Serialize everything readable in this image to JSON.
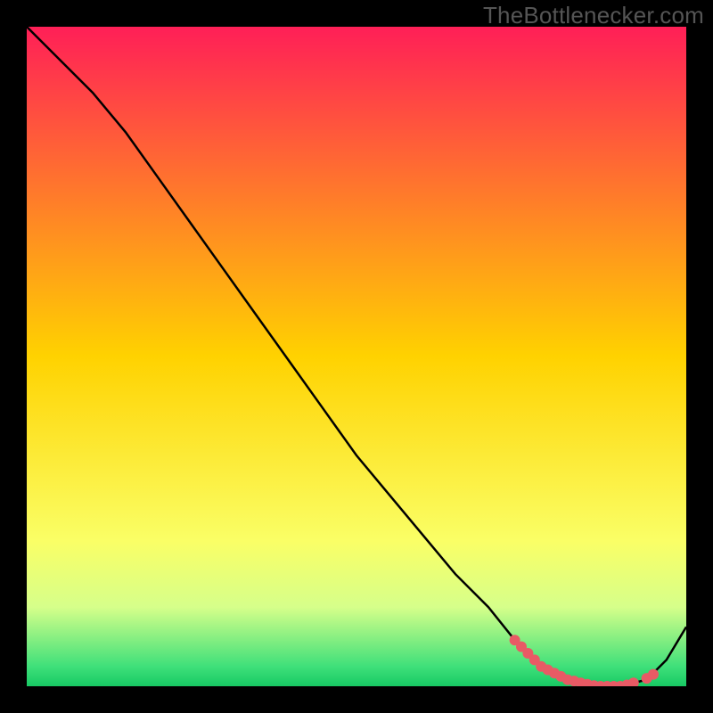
{
  "watermark": "TheBottlenecker.com",
  "chart_data": {
    "type": "line",
    "title": "",
    "xlabel": "",
    "ylabel": "",
    "xlim": [
      0,
      100
    ],
    "ylim": [
      0,
      100
    ],
    "grid": false,
    "legend": false,
    "gradient_stops": [
      {
        "offset": 0.0,
        "color": "#ff1f57"
      },
      {
        "offset": 0.5,
        "color": "#ffd200"
      },
      {
        "offset": 0.78,
        "color": "#faff66"
      },
      {
        "offset": 0.88,
        "color": "#d6ff8a"
      },
      {
        "offset": 0.97,
        "color": "#3fe07a"
      },
      {
        "offset": 1.0,
        "color": "#17c964"
      }
    ],
    "series": [
      {
        "name": "curve",
        "color": "#000000",
        "x": [
          0,
          5,
          10,
          15,
          20,
          25,
          30,
          35,
          40,
          45,
          50,
          55,
          60,
          65,
          70,
          74,
          78,
          82,
          86,
          90,
          94,
          97,
          100
        ],
        "y": [
          100,
          95,
          90,
          84,
          77,
          70,
          63,
          56,
          49,
          42,
          35,
          29,
          23,
          17,
          12,
          7,
          3,
          1,
          0,
          0,
          1,
          4,
          9
        ]
      }
    ],
    "markers": {
      "name": "highlight-points",
      "color": "#e85a65",
      "x": [
        74,
        75,
        76,
        77,
        78,
        79,
        80,
        81,
        82,
        83,
        84,
        85,
        86,
        87,
        88,
        89,
        90,
        91,
        92,
        94,
        95
      ],
      "y": [
        7,
        6,
        5,
        4,
        3,
        2.5,
        2,
        1.5,
        1,
        0.8,
        0.5,
        0.3,
        0.1,
        0,
        0,
        0,
        0,
        0.2,
        0.5,
        1.2,
        1.8
      ]
    }
  }
}
